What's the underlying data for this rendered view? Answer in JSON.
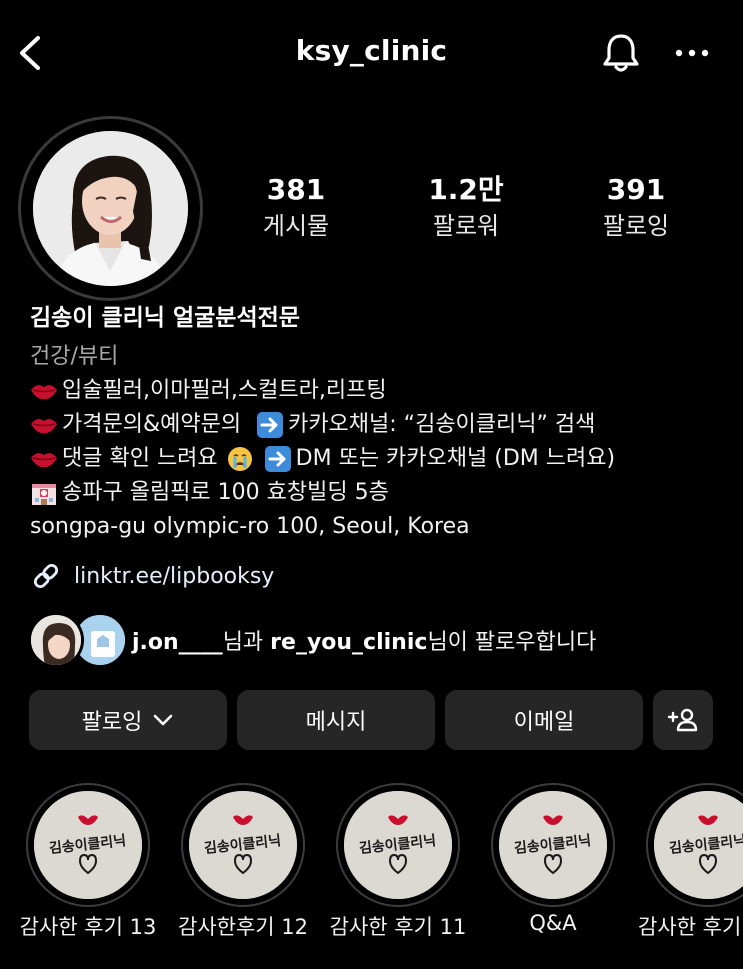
{
  "header": {
    "username": "ksy_clinic",
    "back_icon": "chevron-left-icon",
    "bell_icon": "bell-icon",
    "more_icon": "more-horizontal-icon"
  },
  "stats": [
    {
      "value": "381",
      "label": "게시물"
    },
    {
      "value": "1.2만",
      "label": "팔로워"
    },
    {
      "value": "391",
      "label": "팔로잉"
    }
  ],
  "bio": {
    "name": "김송이 클리닉 얼굴분석전문",
    "category": "건강/뷰티",
    "line1": "입술필러,이마필러,스컬트라,리프팅",
    "line2a": "가격문의&예약문의",
    "line2b": "카카오채널: “김송이클리닉” 검색",
    "line3a": "댓글 확인 느려요",
    "line3b": "DM 또는 카카오채널 (DM 느려요)",
    "line4": "송파구 올림픽로 100 효창빌딩 5층",
    "line5": "songpa-gu olympic-ro 100, Seoul, Korea",
    "link": "linktr.ee/lipbooksy"
  },
  "followed_by": {
    "user1": "j.on____",
    "mid": "님과 ",
    "user2": "re_you_clinic",
    "end": "님이 팔로우합니다"
  },
  "buttons": {
    "following": "팔로잉",
    "message": "메시지",
    "email": "이메일"
  },
  "highlights": [
    {
      "label": "감사한 후기 13",
      "stamp_text": "김송이클리닉"
    },
    {
      "label": "감사한후기 12",
      "stamp_text": "김송이클리닉"
    },
    {
      "label": "감사한 후기 11",
      "stamp_text": "김송이클리닉"
    },
    {
      "label": "Q&A",
      "stamp_text": "김송이클리닉"
    },
    {
      "label": "감사한 후기",
      "stamp_text": "김송이클리닉"
    }
  ],
  "colors": {
    "background": "#000000",
    "button_bg": "#262626",
    "secondary_text": "#a8a8a8",
    "lips_red": "#c8102e"
  }
}
